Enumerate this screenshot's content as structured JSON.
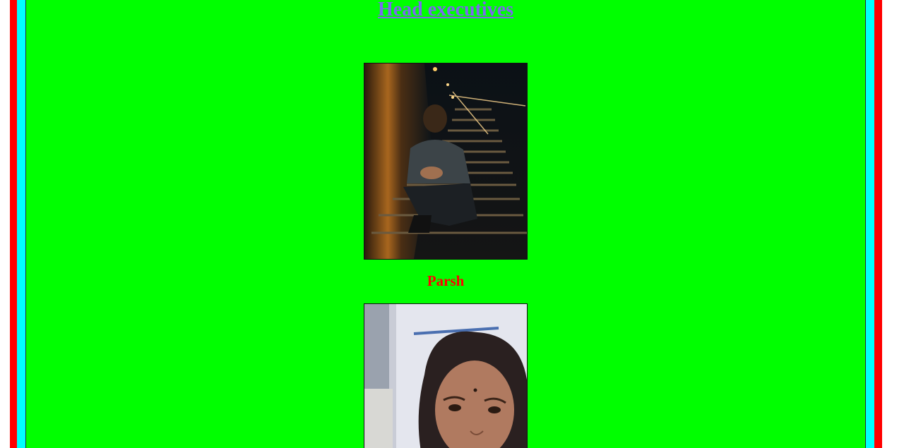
{
  "heading": {
    "title": "Head executives"
  },
  "executives": [
    {
      "name": "Parsh"
    },
    {
      "name": ""
    }
  ],
  "colors": {
    "outer_frame": "#ff0000",
    "inner_frame": "#00ffff",
    "background": "#00ff00",
    "heading_link": "#7b68ee",
    "name_text": "#ff0000"
  }
}
